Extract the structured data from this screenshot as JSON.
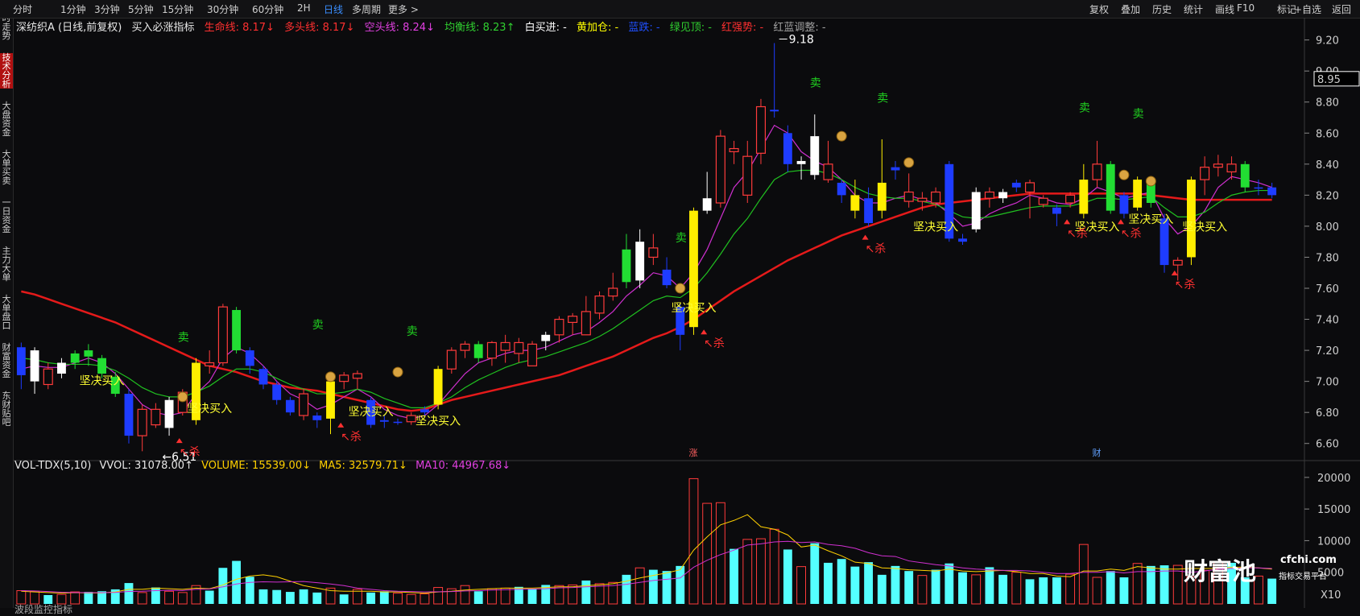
{
  "periods": [
    "分时",
    "1分钟",
    "3分钟",
    "5分钟",
    "15分钟",
    "30分钟",
    "60分钟",
    "2H",
    "日线",
    "多周期",
    "更多 >"
  ],
  "active_period": "日线",
  "right_buttons": [
    "复权",
    "叠加",
    "历史",
    "统计",
    "画线",
    "F10",
    "标记",
    "+自选",
    "返回"
  ],
  "side_tabs": [
    "分时走势",
    "技术分析",
    "大盘资金",
    "大单买卖",
    "一日资金",
    "主力大单",
    "大单盘口",
    "财富资金",
    "东财贴吧"
  ],
  "active_side_tab": "技术分析",
  "info": {
    "stock": "深纺织A (日线,前复权)",
    "indicator": "买入必涨指标",
    "life_line": "生命线: 8.17↓",
    "long_line": "多头线: 8.17↓",
    "short_line": "空头线: 8.24↓",
    "balance_line": "均衡线: 8.23↑",
    "white_buy": "白买进: -",
    "yellow_add": "黄加仓: -",
    "blue_drop": "蓝跌: -",
    "green_top": "绿见顶: -",
    "red_strong": "红强势: -",
    "red_blue_adjust": "红蓝调整: -"
  },
  "price_axis": [
    "9.20",
    "9.00",
    "8.80",
    "8.60",
    "8.40",
    "8.20",
    "8.00",
    "7.80",
    "7.60",
    "7.40",
    "7.20",
    "7.00",
    "6.80",
    "6.60"
  ],
  "current_price_tag": "8.95",
  "high_mark": "9.18",
  "low_mark": "6.51",
  "buy_label": "坚决买入",
  "sell_label": "卖",
  "kill_label": "杀",
  "event_zhang": "涨",
  "event_cai": "财",
  "volume": {
    "title": "VOL-TDX(5,10)",
    "vvol": "VVOL: 31078.00↑",
    "volume": "VOLUME: 15539.00↓",
    "ma5": "MA5: 32579.71↓",
    "ma10": "MA10: 44967.68↓",
    "axis": [
      "20000",
      "15000",
      "10000",
      "5000"
    ],
    "unit": "X10"
  },
  "watermark": {
    "brand": "财富池",
    "url": "cfchi.com",
    "sub": "指标交易平台"
  },
  "bottom_partial": "波段监控指标",
  "colors": {
    "up": "#ff3b3b",
    "down": "#40e0ff",
    "red_line": "#e51a1a",
    "white_line": "#ffffff",
    "magenta_line": "#d030d0",
    "green_line": "#20c020",
    "yellow": "#ffff00",
    "buy_text": "#ffff33"
  },
  "chart_data": {
    "type": "candlestick",
    "ylim": [
      6.5,
      9.25
    ],
    "candles": [
      [
        7.04,
        7.22,
        6.95,
        7.25,
        "blue"
      ],
      [
        7.0,
        7.2,
        6.92,
        7.22,
        "white"
      ],
      [
        7.08,
        6.98,
        6.95,
        7.12,
        "red"
      ],
      [
        7.05,
        7.12,
        7.02,
        7.15,
        "white"
      ],
      [
        7.12,
        7.18,
        7.08,
        7.2,
        "green"
      ],
      [
        7.2,
        7.16,
        7.1,
        7.24,
        "green"
      ],
      [
        7.15,
        7.05,
        7.02,
        7.17,
        "green"
      ],
      [
        7.03,
        6.92,
        6.9,
        7.06,
        "green"
      ],
      [
        6.92,
        6.65,
        6.6,
        6.95,
        "blue"
      ],
      [
        6.65,
        6.82,
        6.55,
        6.85,
        "red"
      ],
      [
        6.82,
        6.72,
        6.7,
        6.86,
        "red"
      ],
      [
        6.7,
        6.88,
        6.65,
        6.9,
        "white"
      ],
      [
        6.8,
        6.93,
        6.78,
        6.95,
        "red"
      ],
      [
        6.75,
        7.12,
        6.72,
        7.15,
        "yellow"
      ],
      [
        7.12,
        7.1,
        7.05,
        7.2,
        "red"
      ],
      [
        7.48,
        7.12,
        7.1,
        7.5,
        "red"
      ],
      [
        7.46,
        7.2,
        7.18,
        7.48,
        "green"
      ],
      [
        7.2,
        7.1,
        7.05,
        7.22,
        "blue"
      ],
      [
        7.08,
        6.98,
        6.95,
        7.1,
        "blue"
      ],
      [
        6.98,
        6.88,
        6.85,
        7.0,
        "blue"
      ],
      [
        6.88,
        6.8,
        6.78,
        6.9,
        "blue"
      ],
      [
        6.92,
        6.78,
        6.75,
        6.95,
        "red"
      ],
      [
        6.78,
        6.75,
        6.7,
        6.8,
        "blue"
      ],
      [
        6.76,
        7.0,
        6.66,
        7.02,
        "yellow"
      ],
      [
        7.04,
        7.0,
        6.95,
        7.06,
        "red"
      ],
      [
        7.02,
        7.05,
        6.95,
        7.07,
        "red"
      ],
      [
        6.88,
        6.72,
        6.7,
        6.9,
        "blue"
      ],
      [
        6.75,
        6.74,
        6.7,
        6.78,
        "blue"
      ],
      [
        6.74,
        6.74,
        6.72,
        6.76,
        "blue"
      ],
      [
        6.74,
        6.78,
        6.72,
        6.8,
        "red"
      ],
      [
        6.8,
        6.82,
        6.78,
        6.84,
        "blue"
      ],
      [
        6.85,
        7.08,
        6.82,
        7.1,
        "yellow"
      ],
      [
        7.08,
        7.2,
        7.05,
        7.22,
        "red"
      ],
      [
        7.2,
        7.24,
        7.15,
        7.26,
        "red"
      ],
      [
        7.24,
        7.15,
        7.12,
        7.26,
        "green"
      ],
      [
        7.15,
        7.25,
        7.1,
        7.26,
        "red"
      ],
      [
        7.2,
        7.25,
        7.12,
        7.3,
        "red"
      ],
      [
        7.25,
        7.18,
        7.12,
        7.28,
        "red"
      ],
      [
        7.24,
        7.1,
        7.1,
        7.26,
        "red"
      ],
      [
        7.3,
        7.26,
        7.2,
        7.32,
        "white"
      ],
      [
        7.3,
        7.4,
        7.25,
        7.42,
        "red"
      ],
      [
        7.38,
        7.42,
        7.3,
        7.44,
        "red"
      ],
      [
        7.45,
        7.3,
        7.3,
        7.55,
        "red"
      ],
      [
        7.44,
        7.55,
        7.4,
        7.58,
        "red"
      ],
      [
        7.55,
        7.6,
        7.52,
        7.7,
        "red"
      ],
      [
        7.85,
        7.64,
        7.6,
        7.95,
        "green"
      ],
      [
        7.65,
        7.9,
        7.6,
        7.98,
        "white"
      ],
      [
        7.86,
        7.8,
        7.75,
        7.95,
        "red"
      ],
      [
        7.72,
        7.62,
        7.6,
        7.8,
        "blue"
      ],
      [
        7.48,
        7.3,
        7.2,
        7.5,
        "blue"
      ],
      [
        7.35,
        8.1,
        7.3,
        8.12,
        "yellow"
      ],
      [
        8.1,
        8.18,
        8.08,
        8.35,
        "white"
      ],
      [
        8.15,
        8.58,
        8.12,
        8.62,
        "red"
      ],
      [
        8.5,
        8.48,
        8.4,
        8.55,
        "red"
      ],
      [
        8.2,
        8.45,
        8.15,
        8.55,
        "red"
      ],
      [
        8.47,
        8.77,
        8.4,
        8.82,
        "red"
      ],
      [
        8.74,
        8.75,
        8.7,
        9.18,
        "blue"
      ],
      [
        8.6,
        8.4,
        8.35,
        8.65,
        "blue"
      ],
      [
        8.4,
        8.42,
        8.3,
        8.45,
        "white"
      ],
      [
        8.58,
        8.33,
        8.3,
        8.72,
        "white"
      ],
      [
        8.4,
        8.3,
        8.28,
        8.55,
        "red"
      ],
      [
        8.28,
        8.2,
        8.15,
        8.3,
        "blue"
      ],
      [
        8.2,
        8.1,
        8.05,
        8.3,
        "yellow"
      ],
      [
        8.18,
        8.02,
        8.0,
        8.25,
        "blue"
      ],
      [
        8.28,
        8.1,
        8.05,
        8.56,
        "yellow"
      ],
      [
        8.38,
        8.36,
        8.3,
        8.42,
        "blue"
      ],
      [
        8.22,
        8.16,
        8.12,
        8.34,
        "red"
      ],
      [
        8.16,
        8.18,
        8.1,
        8.22,
        "red"
      ],
      [
        8.22,
        8.15,
        8.12,
        8.25,
        "red"
      ],
      [
        8.4,
        7.92,
        7.9,
        8.42,
        "blue"
      ],
      [
        7.92,
        7.9,
        7.88,
        7.95,
        "blue"
      ],
      [
        7.98,
        8.22,
        7.96,
        8.25,
        "white"
      ],
      [
        8.22,
        8.18,
        8.12,
        8.25,
        "red"
      ],
      [
        8.22,
        8.18,
        8.15,
        8.24,
        "white"
      ],
      [
        8.25,
        8.28,
        8.22,
        8.3,
        "blue"
      ],
      [
        8.28,
        8.22,
        8.05,
        8.3,
        "red"
      ],
      [
        8.18,
        8.14,
        8.12,
        8.2,
        "red"
      ],
      [
        8.12,
        8.08,
        8.0,
        8.14,
        "blue"
      ],
      [
        8.15,
        8.2,
        8.12,
        8.22,
        "red"
      ],
      [
        8.08,
        8.3,
        8.05,
        8.4,
        "yellow"
      ],
      [
        8.3,
        8.4,
        8.25,
        8.55,
        "red"
      ],
      [
        8.4,
        8.1,
        8.08,
        8.42,
        "green"
      ],
      [
        8.2,
        8.08,
        8.05,
        8.22,
        "blue"
      ],
      [
        8.12,
        8.3,
        8.1,
        8.32,
        "yellow"
      ],
      [
        8.3,
        8.15,
        8.12,
        8.32,
        "green"
      ],
      [
        8.05,
        7.75,
        7.7,
        8.08,
        "blue"
      ],
      [
        7.75,
        7.78,
        7.65,
        7.8,
        "red"
      ],
      [
        7.8,
        8.3,
        7.75,
        8.32,
        "yellow"
      ],
      [
        8.3,
        8.38,
        8.2,
        8.45,
        "red"
      ],
      [
        8.38,
        8.4,
        8.32,
        8.46,
        "red"
      ],
      [
        8.4,
        8.35,
        8.3,
        8.45,
        "red"
      ],
      [
        8.4,
        8.25,
        8.22,
        8.42,
        "green"
      ],
      [
        8.25,
        8.25,
        8.2,
        8.3,
        "blue"
      ],
      [
        8.25,
        8.2,
        8.18,
        8.28,
        "blue"
      ]
    ],
    "volume": [
      2100,
      2000,
      1400,
      1500,
      1900,
      1900,
      2000,
      2300,
      3300,
      1800,
      2600,
      2000,
      1800,
      2900,
      2100,
      5700,
      6800,
      4300,
      2300,
      2200,
      1900,
      2300,
      1800,
      2500,
      1500,
      2300,
      1800,
      2000,
      1700,
      1500,
      1600,
      2600,
      2400,
      2900,
      2000,
      2400,
      2500,
      2700,
      2400,
      3000,
      2900,
      3000,
      3700,
      3200,
      3400,
      4600,
      5700,
      5400,
      5200,
      6000,
      19800,
      15900,
      16000,
      8700,
      10200,
      10300,
      11800,
      8600,
      5900,
      9600,
      6500,
      7100,
      5900,
      6600,
      4600,
      6000,
      5200,
      4500,
      5400,
      6400,
      5000,
      4600,
      5800,
      4600,
      5000,
      3900,
      4200,
      4200,
      4700,
      9400,
      4200,
      5200,
      4200,
      6400,
      6000,
      6100,
      6100,
      4300,
      5300,
      6500,
      6500,
      4200,
      4400,
      4000
    ],
    "series": [
      {
        "name": "生命线",
        "color": "#e51a1a",
        "values": [
          7.58,
          7.56,
          7.53,
          7.5,
          7.47,
          7.44,
          7.41,
          7.38,
          7.34,
          7.3,
          7.26,
          7.22,
          7.18,
          7.14,
          7.1,
          7.08,
          7.06,
          7.03,
          7.0,
          6.98,
          6.96,
          6.95,
          6.94,
          6.92,
          6.9,
          6.88,
          6.86,
          6.84,
          6.82,
          6.81,
          6.82,
          6.85,
          6.88,
          6.9,
          6.92,
          6.94,
          6.96,
          6.98,
          7.0,
          7.02,
          7.04,
          7.07,
          7.1,
          7.13,
          7.16,
          7.2,
          7.24,
          7.28,
          7.31,
          7.35,
          7.4,
          7.46,
          7.52,
          7.58,
          7.63,
          7.68,
          7.73,
          7.78,
          7.82,
          7.86,
          7.9,
          7.94,
          7.97,
          8.0,
          8.03,
          8.06,
          8.09,
          8.12,
          8.14,
          8.15,
          8.16,
          8.17,
          8.18,
          8.19,
          8.2,
          8.21,
          8.21,
          8.21,
          8.21,
          8.21,
          8.21,
          8.21,
          8.21,
          8.21,
          8.2,
          8.19,
          8.18,
          8.17,
          8.17,
          8.17,
          8.17,
          8.17,
          8.17,
          8.17
        ]
      },
      {
        "name": "多头线",
        "color": "#d030d0",
        "values": [
          7.08,
          7.1,
          7.09,
          7.09,
          7.12,
          7.15,
          7.12,
          7.05,
          6.95,
          6.85,
          6.8,
          6.78,
          6.8,
          6.92,
          7.0,
          7.15,
          7.22,
          7.18,
          7.1,
          7.0,
          6.92,
          6.88,
          6.82,
          6.85,
          6.9,
          6.95,
          6.9,
          6.82,
          6.78,
          6.76,
          6.78,
          6.85,
          6.95,
          7.05,
          7.12,
          7.15,
          7.18,
          7.2,
          7.2,
          7.22,
          7.26,
          7.3,
          7.32,
          7.38,
          7.45,
          7.55,
          7.62,
          7.7,
          7.68,
          7.6,
          7.7,
          7.85,
          8.05,
          8.25,
          8.35,
          8.5,
          8.65,
          8.6,
          8.48,
          8.42,
          8.38,
          8.3,
          8.2,
          8.15,
          8.15,
          8.18,
          8.2,
          8.17,
          8.15,
          8.08,
          8.0,
          8.02,
          8.08,
          8.12,
          8.15,
          8.2,
          8.18,
          8.15,
          8.14,
          8.18,
          8.25,
          8.22,
          8.18,
          8.2,
          8.22,
          8.05,
          7.95,
          8.0,
          8.1,
          8.25,
          8.32,
          8.3,
          8.28,
          8.25
        ]
      },
      {
        "name": "均衡线",
        "color": "#20c020",
        "values": [
          7.15,
          7.14,
          7.12,
          7.11,
          7.11,
          7.11,
          7.1,
          7.07,
          7.02,
          6.96,
          6.92,
          6.9,
          6.9,
          6.93,
          6.97,
          7.03,
          7.08,
          7.08,
          7.06,
          7.02,
          6.98,
          6.95,
          6.92,
          6.92,
          6.93,
          6.95,
          6.93,
          6.89,
          6.86,
          6.83,
          6.83,
          6.86,
          6.9,
          6.96,
          7.01,
          7.05,
          7.09,
          7.12,
          7.14,
          7.16,
          7.19,
          7.22,
          7.25,
          7.29,
          7.34,
          7.4,
          7.46,
          7.52,
          7.55,
          7.54,
          7.6,
          7.7,
          7.82,
          7.95,
          8.05,
          8.18,
          8.3,
          8.35,
          8.36,
          8.36,
          8.34,
          8.3,
          8.25,
          8.21,
          8.19,
          8.18,
          8.18,
          8.16,
          8.14,
          8.1,
          8.06,
          8.05,
          8.06,
          8.08,
          8.1,
          8.12,
          8.13,
          8.13,
          8.13,
          8.15,
          8.18,
          8.18,
          8.17,
          8.18,
          8.19,
          8.12,
          8.06,
          8.06,
          8.09,
          8.15,
          8.2,
          8.22,
          8.23,
          8.23
        ]
      }
    ],
    "vol_ma5": [
      2000,
      1900,
      1800,
      1700,
      1780,
      1740,
      1740,
      1900,
      2300,
      2300,
      2500,
      2400,
      2300,
      2500,
      2400,
      3000,
      3900,
      4400,
      4600,
      4300,
      3600,
      2900,
      2500,
      2100,
      2000,
      2000,
      2000,
      1900,
      1900,
      1800,
      1700,
      1900,
      2000,
      2200,
      2300,
      2400,
      2500,
      2500,
      2500,
      2600,
      2700,
      2700,
      2900,
      3000,
      3200,
      3600,
      4100,
      4500,
      4900,
      5400,
      8500,
      10600,
      12500,
      13200,
      14100,
      12200,
      11800,
      10900,
      9000,
      9300,
      8400,
      7600,
      6600,
      6400,
      5700,
      5600,
      5400,
      5300,
      5200,
      5500,
      5200,
      5100,
      5200,
      5300,
      5100,
      4800,
      4800,
      4400,
      4300,
      5200,
      5200,
      5500,
      5300,
      5900,
      5700,
      5500,
      5500,
      5600,
      5600,
      5600,
      5800,
      5800,
      5700,
      5500
    ],
    "vol_ma10": [
      2100,
      2050,
      1950,
      1850,
      1800,
      1780,
      1780,
      1820,
      1980,
      2000,
      2100,
      2150,
      2120,
      2300,
      2350,
      2700,
      3150,
      3400,
      3500,
      3450,
      3500,
      3550,
      3350,
      3150,
      2900,
      2500,
      2300,
      2100,
      2000,
      1950,
      1900,
      1920,
      1950,
      2050,
      2100,
      2200,
      2250,
      2300,
      2350,
      2400,
      2550,
      2600,
      2700,
      2800,
      2900,
      3100,
      3400,
      3700,
      3900,
      4100,
      5800,
      6900,
      7800,
      8500,
      9300,
      9500,
      9800,
      9900,
      9700,
      9800,
      9400,
      9200,
      8800,
      8100,
      7600,
      7500,
      6800,
      6500,
      6200,
      6000,
      5700,
      5500,
      5400,
      5300,
      5300,
      5200,
      5000,
      4800,
      4800,
      5000,
      5000,
      5100,
      4900,
      5100,
      5100,
      5200,
      5200,
      5000,
      5200,
      5500,
      5600,
      5700,
      5700,
      5600
    ]
  }
}
